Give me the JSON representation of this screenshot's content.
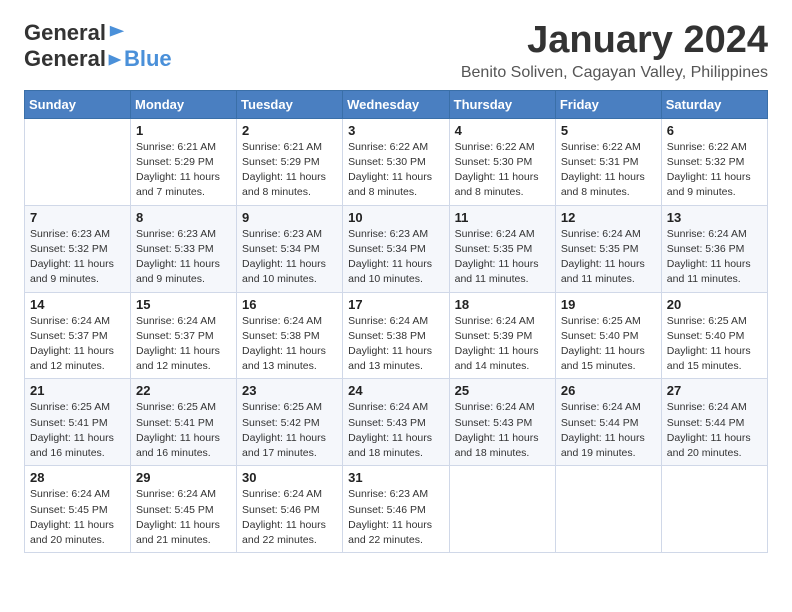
{
  "header": {
    "logo_general": "General",
    "logo_blue": "Blue",
    "month_title": "January 2024",
    "location": "Benito Soliven, Cagayan Valley, Philippines"
  },
  "columns": [
    "Sunday",
    "Monday",
    "Tuesday",
    "Wednesday",
    "Thursday",
    "Friday",
    "Saturday"
  ],
  "weeks": [
    [
      {
        "day": "",
        "info": ""
      },
      {
        "day": "1",
        "info": "Sunrise: 6:21 AM\nSunset: 5:29 PM\nDaylight: 11 hours\nand 7 minutes."
      },
      {
        "day": "2",
        "info": "Sunrise: 6:21 AM\nSunset: 5:29 PM\nDaylight: 11 hours\nand 8 minutes."
      },
      {
        "day": "3",
        "info": "Sunrise: 6:22 AM\nSunset: 5:30 PM\nDaylight: 11 hours\nand 8 minutes."
      },
      {
        "day": "4",
        "info": "Sunrise: 6:22 AM\nSunset: 5:30 PM\nDaylight: 11 hours\nand 8 minutes."
      },
      {
        "day": "5",
        "info": "Sunrise: 6:22 AM\nSunset: 5:31 PM\nDaylight: 11 hours\nand 8 minutes."
      },
      {
        "day": "6",
        "info": "Sunrise: 6:22 AM\nSunset: 5:32 PM\nDaylight: 11 hours\nand 9 minutes."
      }
    ],
    [
      {
        "day": "7",
        "info": "Sunrise: 6:23 AM\nSunset: 5:32 PM\nDaylight: 11 hours\nand 9 minutes."
      },
      {
        "day": "8",
        "info": "Sunrise: 6:23 AM\nSunset: 5:33 PM\nDaylight: 11 hours\nand 9 minutes."
      },
      {
        "day": "9",
        "info": "Sunrise: 6:23 AM\nSunset: 5:34 PM\nDaylight: 11 hours\nand 10 minutes."
      },
      {
        "day": "10",
        "info": "Sunrise: 6:23 AM\nSunset: 5:34 PM\nDaylight: 11 hours\nand 10 minutes."
      },
      {
        "day": "11",
        "info": "Sunrise: 6:24 AM\nSunset: 5:35 PM\nDaylight: 11 hours\nand 11 minutes."
      },
      {
        "day": "12",
        "info": "Sunrise: 6:24 AM\nSunset: 5:35 PM\nDaylight: 11 hours\nand 11 minutes."
      },
      {
        "day": "13",
        "info": "Sunrise: 6:24 AM\nSunset: 5:36 PM\nDaylight: 11 hours\nand 11 minutes."
      }
    ],
    [
      {
        "day": "14",
        "info": "Sunrise: 6:24 AM\nSunset: 5:37 PM\nDaylight: 11 hours\nand 12 minutes."
      },
      {
        "day": "15",
        "info": "Sunrise: 6:24 AM\nSunset: 5:37 PM\nDaylight: 11 hours\nand 12 minutes."
      },
      {
        "day": "16",
        "info": "Sunrise: 6:24 AM\nSunset: 5:38 PM\nDaylight: 11 hours\nand 13 minutes."
      },
      {
        "day": "17",
        "info": "Sunrise: 6:24 AM\nSunset: 5:38 PM\nDaylight: 11 hours\nand 13 minutes."
      },
      {
        "day": "18",
        "info": "Sunrise: 6:24 AM\nSunset: 5:39 PM\nDaylight: 11 hours\nand 14 minutes."
      },
      {
        "day": "19",
        "info": "Sunrise: 6:25 AM\nSunset: 5:40 PM\nDaylight: 11 hours\nand 15 minutes."
      },
      {
        "day": "20",
        "info": "Sunrise: 6:25 AM\nSunset: 5:40 PM\nDaylight: 11 hours\nand 15 minutes."
      }
    ],
    [
      {
        "day": "21",
        "info": "Sunrise: 6:25 AM\nSunset: 5:41 PM\nDaylight: 11 hours\nand 16 minutes."
      },
      {
        "day": "22",
        "info": "Sunrise: 6:25 AM\nSunset: 5:41 PM\nDaylight: 11 hours\nand 16 minutes."
      },
      {
        "day": "23",
        "info": "Sunrise: 6:25 AM\nSunset: 5:42 PM\nDaylight: 11 hours\nand 17 minutes."
      },
      {
        "day": "24",
        "info": "Sunrise: 6:24 AM\nSunset: 5:43 PM\nDaylight: 11 hours\nand 18 minutes."
      },
      {
        "day": "25",
        "info": "Sunrise: 6:24 AM\nSunset: 5:43 PM\nDaylight: 11 hours\nand 18 minutes."
      },
      {
        "day": "26",
        "info": "Sunrise: 6:24 AM\nSunset: 5:44 PM\nDaylight: 11 hours\nand 19 minutes."
      },
      {
        "day": "27",
        "info": "Sunrise: 6:24 AM\nSunset: 5:44 PM\nDaylight: 11 hours\nand 20 minutes."
      }
    ],
    [
      {
        "day": "28",
        "info": "Sunrise: 6:24 AM\nSunset: 5:45 PM\nDaylight: 11 hours\nand 20 minutes."
      },
      {
        "day": "29",
        "info": "Sunrise: 6:24 AM\nSunset: 5:45 PM\nDaylight: 11 hours\nand 21 minutes."
      },
      {
        "day": "30",
        "info": "Sunrise: 6:24 AM\nSunset: 5:46 PM\nDaylight: 11 hours\nand 22 minutes."
      },
      {
        "day": "31",
        "info": "Sunrise: 6:23 AM\nSunset: 5:46 PM\nDaylight: 11 hours\nand 22 minutes."
      },
      {
        "day": "",
        "info": ""
      },
      {
        "day": "",
        "info": ""
      },
      {
        "day": "",
        "info": ""
      }
    ]
  ]
}
